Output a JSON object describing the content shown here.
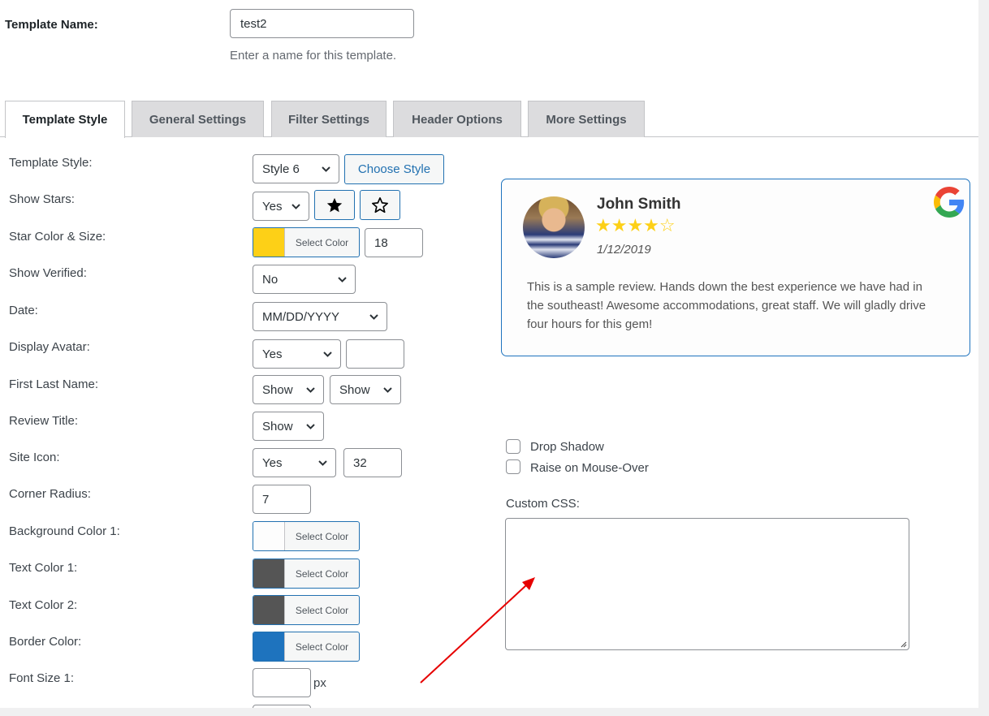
{
  "template_name": {
    "label": "Template Name:",
    "value": "test2",
    "help": "Enter a name for this template."
  },
  "tabs": [
    {
      "label": "Template Style",
      "active": true
    },
    {
      "label": "General Settings",
      "active": false
    },
    {
      "label": "Filter Settings",
      "active": false
    },
    {
      "label": "Header Options",
      "active": false
    },
    {
      "label": "More Settings",
      "active": false
    }
  ],
  "settings": {
    "template_style": {
      "label": "Template Style:",
      "value": "Style 6",
      "button": "Choose Style"
    },
    "show_stars": {
      "label": "Show Stars:",
      "value": "Yes",
      "filled_star_icon": "star-filled-icon",
      "outline_star_icon": "star-outline-icon"
    },
    "star_color_size": {
      "label": "Star Color & Size:",
      "button": "Select Color",
      "swatch": "#fdd017",
      "size": "18"
    },
    "show_verified": {
      "label": "Show Verified:",
      "value": "No"
    },
    "date": {
      "label": "Date:",
      "value": "MM/DD/YYYY"
    },
    "display_avatar": {
      "label": "Display Avatar:",
      "value": "Yes",
      "extra": ""
    },
    "first_last_name": {
      "label": "First Last Name:",
      "first": "Show",
      "last": "Show"
    },
    "review_title": {
      "label": "Review Title:",
      "value": "Show"
    },
    "site_icon": {
      "label": "Site Icon:",
      "value": "Yes",
      "size": "32"
    },
    "corner_radius": {
      "label": "Corner Radius:",
      "value": "7"
    },
    "background_color_1": {
      "label": "Background Color 1:",
      "button": "Select Color",
      "swatch": "#fdfdfd"
    },
    "text_color_1": {
      "label": "Text Color 1:",
      "button": "Select Color",
      "swatch": "#555555"
    },
    "text_color_2": {
      "label": "Text Color 2:",
      "button": "Select Color",
      "swatch": "#555555"
    },
    "border_color": {
      "label": "Border Color:",
      "button": "Select Color",
      "swatch": "#1e73be"
    },
    "font_size_1": {
      "label": "Font Size 1:",
      "value": "",
      "unit": "px"
    }
  },
  "preview": {
    "name": "John Smith",
    "rating": 4,
    "stars_display": "★★★★☆",
    "date": "1/12/2019",
    "text": "This is a sample review. Hands down the best experience we have had in the southeast! Awesome accommodations, great staff. We will gladly drive four hours for this gem!",
    "site_icon": "google-icon"
  },
  "options": {
    "drop_shadow": {
      "label": "Drop Shadow",
      "checked": false
    },
    "raise_on_hover": {
      "label": "Raise on Mouse-Over",
      "checked": false
    },
    "custom_css": {
      "label": "Custom CSS:",
      "value": ""
    }
  },
  "colors": {
    "accent": "#2271b1",
    "star": "#fdd017",
    "card_border": "#1e73be",
    "annotation_arrow": "#e60000"
  }
}
